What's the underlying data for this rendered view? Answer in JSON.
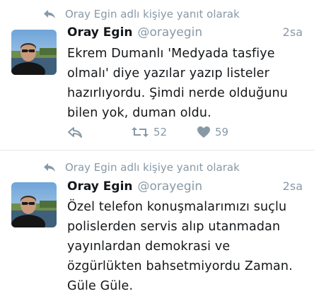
{
  "tweets": [
    {
      "context": "Oray Egin adlı kişiye yanıt olarak",
      "display_name": "Oray Egin",
      "handle": "@orayegin",
      "time": "2sa",
      "text": "Ekrem Dumanlı 'Medyada tasfiye\nolmalı' diye yazılar yazıp listeler\nhazırlıyordu. Şimdi nerde olduğunu\nbilen yok, duman oldu.",
      "retweets": "52",
      "likes": "59"
    },
    {
      "context": "Oray Egin adlı kişiye yanıt olarak",
      "display_name": "Oray Egin",
      "handle": "@orayegin",
      "time": "2sa",
      "text": "Özel telefon konuşmalarımızı suçlu\npolislerden servis alıp utanmadan\nyayınlardan demokrasi ve\nözgürlükten bahsetmiyordu Zaman.\nGüle Güle."
    }
  ],
  "colors": {
    "muted": "#8899a6",
    "text": "#14171a",
    "separator": "#e1e8ed"
  },
  "icons": {
    "context": "reply-arrow-icon",
    "reply": "reply-icon",
    "retweet": "retweet-icon",
    "like": "heart-icon"
  }
}
